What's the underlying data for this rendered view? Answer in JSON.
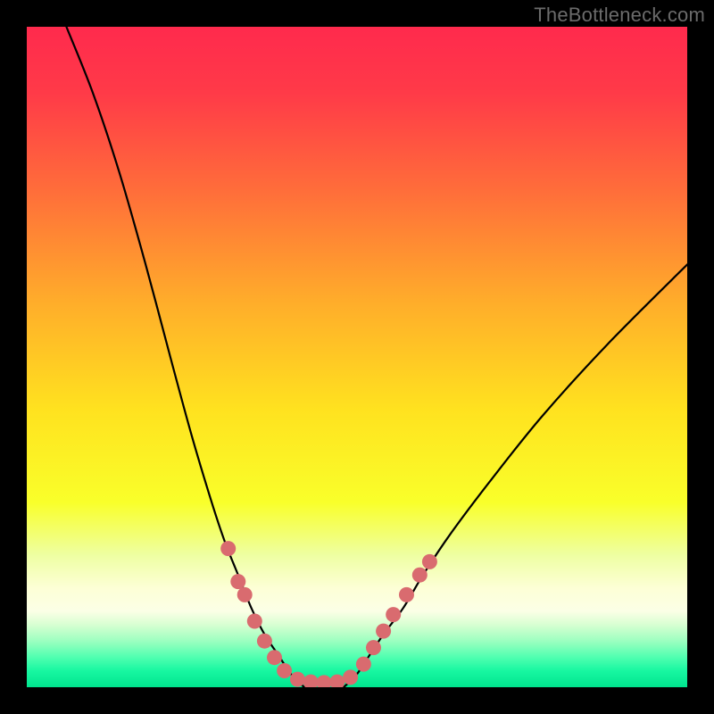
{
  "watermark": "TheBottleneck.com",
  "chart_data": {
    "type": "line",
    "title": "",
    "xlabel": "",
    "ylabel": "",
    "xlim": [
      0,
      100
    ],
    "ylim": [
      0,
      100
    ],
    "grid": false,
    "legend": false,
    "series": [
      {
        "name": "left-curve",
        "x": [
          6,
          10,
          14,
          18,
          22,
          25,
          28,
          30,
          32,
          34,
          36,
          38,
          40,
          42
        ],
        "y": [
          100,
          90,
          78,
          64,
          49,
          38,
          28,
          22,
          17,
          12,
          8,
          5,
          2,
          0
        ]
      },
      {
        "name": "right-curve",
        "x": [
          48,
          50,
          52,
          54,
          57,
          60,
          64,
          70,
          78,
          88,
          100
        ],
        "y": [
          0,
          2,
          5,
          8,
          12,
          17,
          23,
          31,
          41,
          52,
          64
        ]
      }
    ],
    "markers": {
      "name": "highlight-dots",
      "color": "#d96b6f",
      "points": [
        {
          "x": 30.5,
          "y": 21
        },
        {
          "x": 32,
          "y": 16
        },
        {
          "x": 33,
          "y": 14
        },
        {
          "x": 34.5,
          "y": 10
        },
        {
          "x": 36,
          "y": 7
        },
        {
          "x": 37.5,
          "y": 4.5
        },
        {
          "x": 39,
          "y": 2.5
        },
        {
          "x": 41,
          "y": 1.2
        },
        {
          "x": 43,
          "y": 0.8
        },
        {
          "x": 45,
          "y": 0.7
        },
        {
          "x": 47,
          "y": 0.8
        },
        {
          "x": 49,
          "y": 1.5
        },
        {
          "x": 51,
          "y": 3.5
        },
        {
          "x": 52.5,
          "y": 6
        },
        {
          "x": 54,
          "y": 8.5
        },
        {
          "x": 55.5,
          "y": 11
        },
        {
          "x": 57.5,
          "y": 14
        },
        {
          "x": 59.5,
          "y": 17
        },
        {
          "x": 61,
          "y": 19
        }
      ]
    },
    "gradient_stops": [
      {
        "offset": 0.0,
        "color": "#ff2a4d"
      },
      {
        "offset": 0.1,
        "color": "#ff3a48"
      },
      {
        "offset": 0.25,
        "color": "#ff6e3a"
      },
      {
        "offset": 0.42,
        "color": "#ffae2a"
      },
      {
        "offset": 0.58,
        "color": "#ffe21f"
      },
      {
        "offset": 0.72,
        "color": "#f9ff2a"
      },
      {
        "offset": 0.8,
        "color": "#eeffa2"
      },
      {
        "offset": 0.85,
        "color": "#fdffd6"
      },
      {
        "offset": 0.885,
        "color": "#fbffe6"
      },
      {
        "offset": 0.905,
        "color": "#d8ffd2"
      },
      {
        "offset": 0.93,
        "color": "#9cffc0"
      },
      {
        "offset": 0.955,
        "color": "#4fffb0"
      },
      {
        "offset": 0.975,
        "color": "#18f7a1"
      },
      {
        "offset": 1.0,
        "color": "#00e58e"
      }
    ]
  }
}
